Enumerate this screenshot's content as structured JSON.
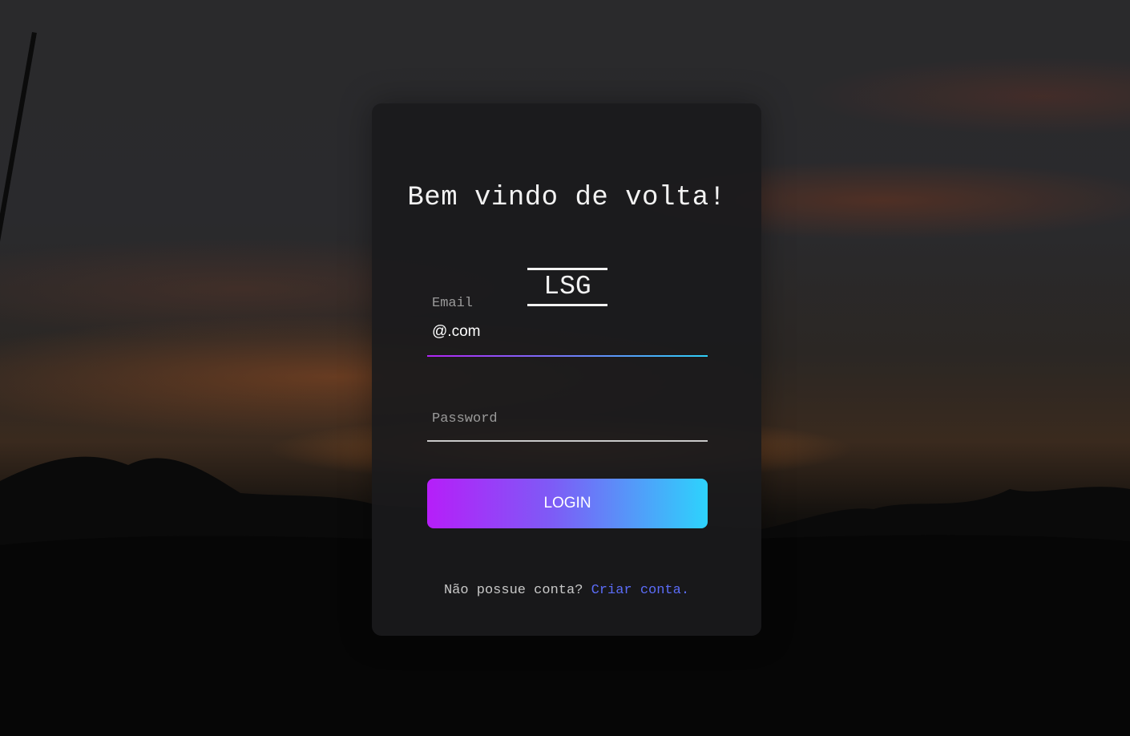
{
  "colors": {
    "card_background": "#1a1a1c",
    "button_gradient_start": "#b61ef9",
    "button_gradient_end": "#2dd3fc",
    "link": "#5b6cf7",
    "text": "#f2f2f2"
  },
  "login": {
    "title": "Bem vindo de volta!",
    "logo_text": "LSG",
    "email": {
      "label": "Email",
      "value": "@.com"
    },
    "password": {
      "placeholder": "Password"
    },
    "submit_label": "LOGIN",
    "signup_prompt": "Não possue conta?",
    "signup_link": "Criar conta."
  },
  "icons": {
    "logo": "lsg-logo-icon"
  }
}
